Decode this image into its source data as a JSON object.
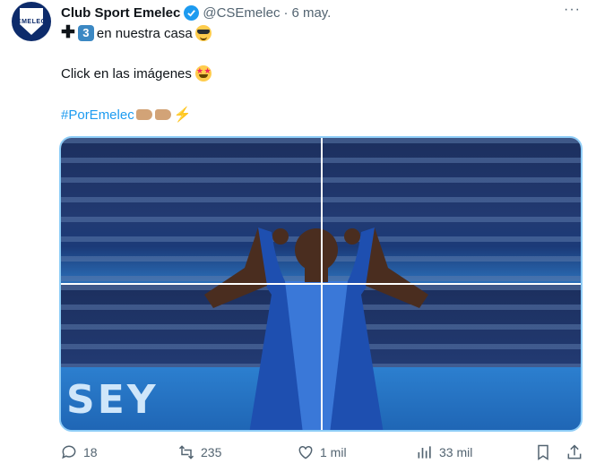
{
  "author": {
    "name": "Club Sport Emelec",
    "handle": "@CSEmelec",
    "separator": "·",
    "date": "6 may.",
    "verified": true,
    "avatar_text": "EMELEC"
  },
  "more_label": "···",
  "text": {
    "line1_keycap": "3",
    "line1_text": "en nuestra casa",
    "line2": "Click en las imágenes",
    "hashtag": "#PorEmelec"
  },
  "media": {
    "banner_text": "SEY"
  },
  "actions": {
    "replies": "18",
    "reposts": "235",
    "likes": "1 mil",
    "views": "33 mil"
  },
  "colors": {
    "accent": "#1d9bf0",
    "muted": "#536471",
    "media_border": "#8ecdf7"
  }
}
